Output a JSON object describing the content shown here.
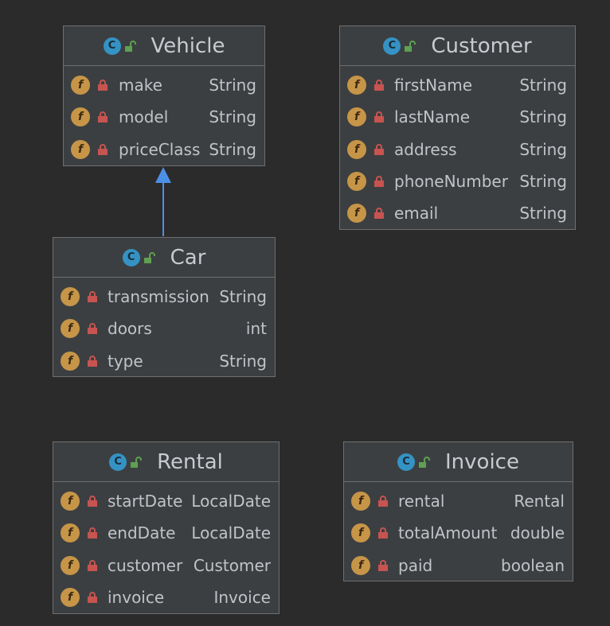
{
  "colors": {
    "background": "#2b2b2b",
    "class_fill": "#3c3f41",
    "class_border": "#6e6e6e",
    "class_icon": "#3592c4",
    "field_icon": "#c69548",
    "private_lock": "#c75450",
    "public_lock": "#5fa052",
    "inheritance_arrow": "#4c8fe6"
  },
  "icons": {
    "class_icon_letter": "C",
    "field_icon_letter": "f"
  },
  "classes": {
    "vehicle": {
      "name": "Vehicle",
      "fields": [
        {
          "name": "make",
          "type": "String"
        },
        {
          "name": "model",
          "type": "String"
        },
        {
          "name": "priceClass",
          "type": "String"
        }
      ]
    },
    "customer": {
      "name": "Customer",
      "fields": [
        {
          "name": "firstName",
          "type": "String"
        },
        {
          "name": "lastName",
          "type": "String"
        },
        {
          "name": "address",
          "type": "String"
        },
        {
          "name": "phoneNumber",
          "type": "String"
        },
        {
          "name": "email",
          "type": "String"
        }
      ]
    },
    "car": {
      "name": "Car",
      "fields": [
        {
          "name": "transmission",
          "type": "String"
        },
        {
          "name": "doors",
          "type": "int"
        },
        {
          "name": "type",
          "type": "String"
        }
      ]
    },
    "rental": {
      "name": "Rental",
      "fields": [
        {
          "name": "startDate",
          "type": "LocalDate"
        },
        {
          "name": "endDate",
          "type": "LocalDate"
        },
        {
          "name": "customer",
          "type": "Customer"
        },
        {
          "name": "invoice",
          "type": "Invoice"
        }
      ]
    },
    "invoice": {
      "name": "Invoice",
      "fields": [
        {
          "name": "rental",
          "type": "Rental"
        },
        {
          "name": "totalAmount",
          "type": "double"
        },
        {
          "name": "paid",
          "type": "boolean"
        }
      ]
    }
  },
  "relations": [
    {
      "from": "car",
      "to": "vehicle",
      "kind": "inheritance"
    }
  ]
}
